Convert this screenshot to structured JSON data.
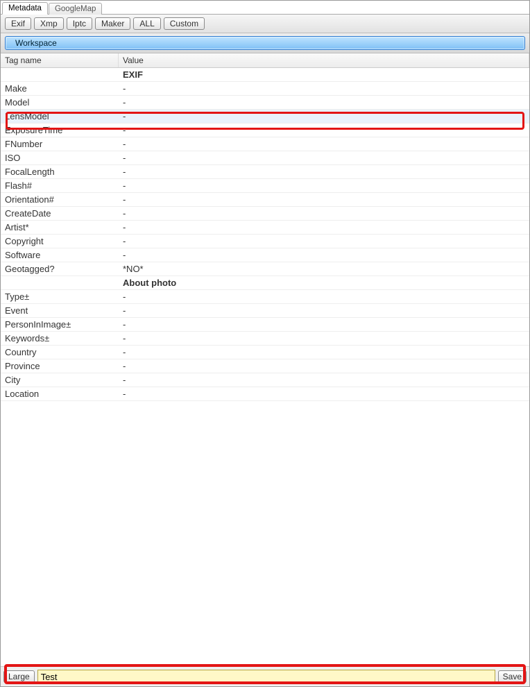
{
  "tabs": {
    "active": "Metadata",
    "inactive": "GoogleMap"
  },
  "toolbar": {
    "exif": "Exif",
    "xmp": "Xmp",
    "iptc": "Iptc",
    "maker": "Maker",
    "all": "ALL",
    "custom": "Custom",
    "workspace": "Workspace"
  },
  "columns": {
    "tag": "Tag name",
    "value": "Value"
  },
  "sections": {
    "exif": "EXIF",
    "about": "About photo"
  },
  "rows": {
    "make": {
      "label": "Make",
      "value": "-"
    },
    "model": {
      "label": "Model",
      "value": "-"
    },
    "lensmodel": {
      "label": "LensModel",
      "value": "-"
    },
    "exposure": {
      "label": "ExposureTime",
      "value": "-"
    },
    "fnumber": {
      "label": "FNumber",
      "value": "-"
    },
    "iso": {
      "label": "ISO",
      "value": "-"
    },
    "focal": {
      "label": "FocalLength",
      "value": "-"
    },
    "flash": {
      "label": "Flash#",
      "value": "-"
    },
    "orient": {
      "label": "Orientation#",
      "value": "-"
    },
    "created": {
      "label": "CreateDate",
      "value": "-"
    },
    "artist": {
      "label": "Artist*",
      "value": "-"
    },
    "copyright": {
      "label": "Copyright",
      "value": "-"
    },
    "software": {
      "label": "Software",
      "value": "-"
    },
    "geotagged": {
      "label": "Geotagged?",
      "value": "*NO*"
    },
    "type": {
      "label": "Type±",
      "value": "-"
    },
    "event": {
      "label": "Event",
      "value": "-"
    },
    "person": {
      "label": "PersonInImage±",
      "value": "-"
    },
    "keywords": {
      "label": "Keywords±",
      "value": "-"
    },
    "country": {
      "label": "Country",
      "value": "-"
    },
    "province": {
      "label": "Province",
      "value": "-"
    },
    "city": {
      "label": "City",
      "value": "-"
    },
    "location": {
      "label": "Location",
      "value": "-"
    }
  },
  "bottom": {
    "large": "Large",
    "input_value": "Test",
    "save": "Save"
  }
}
